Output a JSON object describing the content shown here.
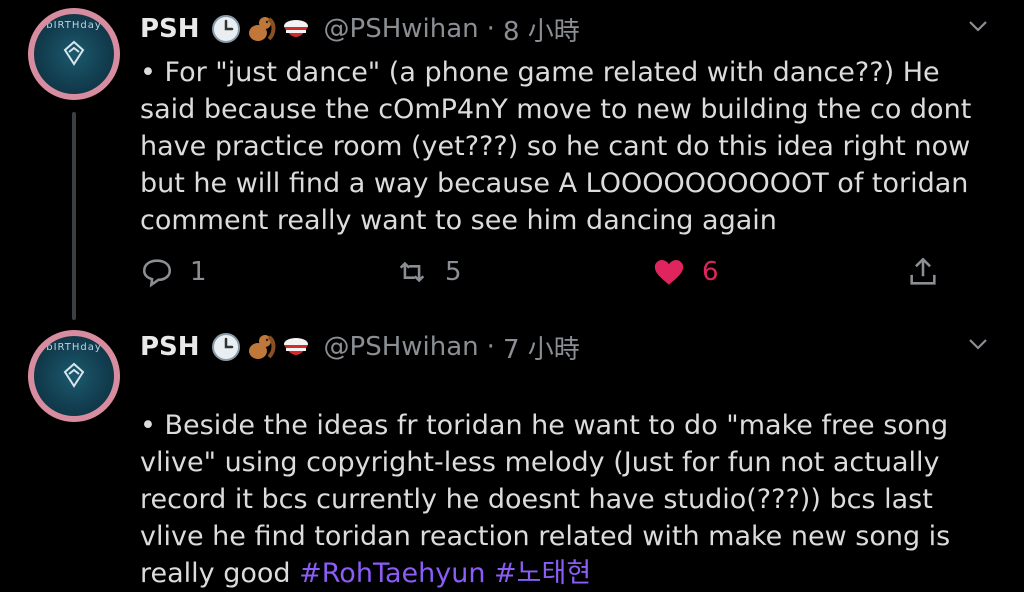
{
  "tweets": [
    {
      "author": "PSH",
      "handle": "@PSHwihan",
      "separator": "·",
      "time": "8 小時",
      "text": "• For \"just dance\" (a phone game related with dance??) He said because the cOmP4nY move to new building the co dont have practice room (yet???) so he cant do this idea right now but he will find a way because A LOOOOOOOOOOT of toridan comment really want to see him dancing again",
      "reply_count": "1",
      "retweet_count": "5",
      "like_count": "6",
      "avatar_ring_text": "bIRTHday"
    },
    {
      "author": "PSH",
      "handle": "@PSHwihan",
      "separator": "·",
      "time": "7 小時",
      "text": "• Beside the ideas fr toridan he want to do \"make free song vlive\" using copyright-less melody (Just for fun not actually record it bcs currently he doesnt have studio(???)) bcs last vlive he find toridan reaction related with make new song is really good ",
      "hashtags": [
        "#RohTaehyun",
        "#노태현"
      ],
      "avatar_ring_text": "bIRTHday"
    }
  ],
  "colors": {
    "like": "#e0245e",
    "hashtag": "#8b5cf6",
    "muted": "#8b8f93",
    "background": "#000000"
  },
  "icons": [
    "clock-emoji",
    "chipmunk-emoji",
    "rice-emoji",
    "chevron-down-icon",
    "reply-icon",
    "retweet-icon",
    "heart-icon",
    "share-icon"
  ]
}
